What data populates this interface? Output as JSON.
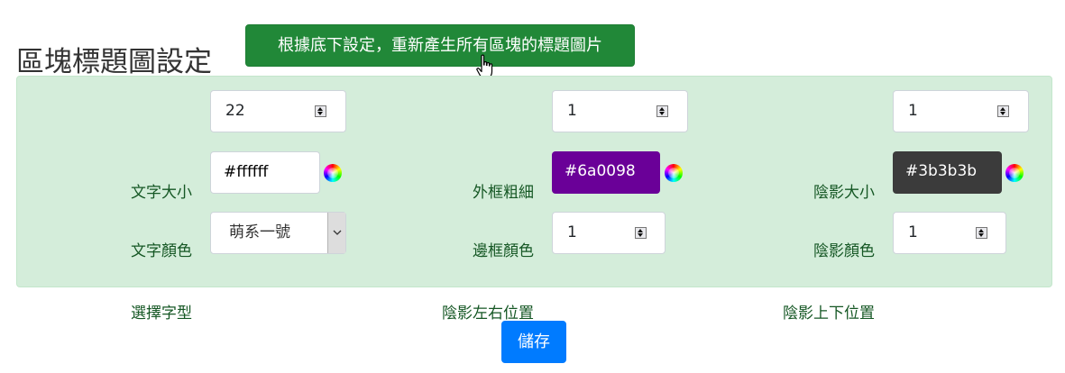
{
  "page": {
    "title": "區塊標題圖設定",
    "regenerate_button": "根據底下設定，重新產生所有區塊的標題圖片",
    "save_button": "儲存"
  },
  "settings": {
    "font_size": {
      "label": "文字大小",
      "value": "22"
    },
    "border_width": {
      "label": "外框粗細",
      "value": "1"
    },
    "shadow_size": {
      "label": "陰影大小",
      "value": "1"
    },
    "text_color": {
      "label": "文字顏色",
      "value": "#ffffff",
      "swatch": "#ffffff",
      "text_color": "#000000"
    },
    "border_color": {
      "label": "邊框顏色",
      "value": "#6a0098",
      "swatch": "#6a0098",
      "text_color": "#ffffff"
    },
    "shadow_color": {
      "label": "陰影顏色",
      "value": "#3b3b3b",
      "swatch": "#3b3b3b",
      "text_color": "#ffffff"
    },
    "font_family": {
      "label": "選擇字型",
      "value": "萌系一號"
    },
    "shadow_x": {
      "label": "陰影左右位置",
      "value": "1"
    },
    "shadow_y": {
      "label": "陰影上下位置",
      "value": "1"
    }
  },
  "colors": {
    "regenerate_button_bg": "#218838",
    "panel_bg": "#d4edda",
    "label_text": "#155724",
    "save_button_bg": "#007bff"
  }
}
